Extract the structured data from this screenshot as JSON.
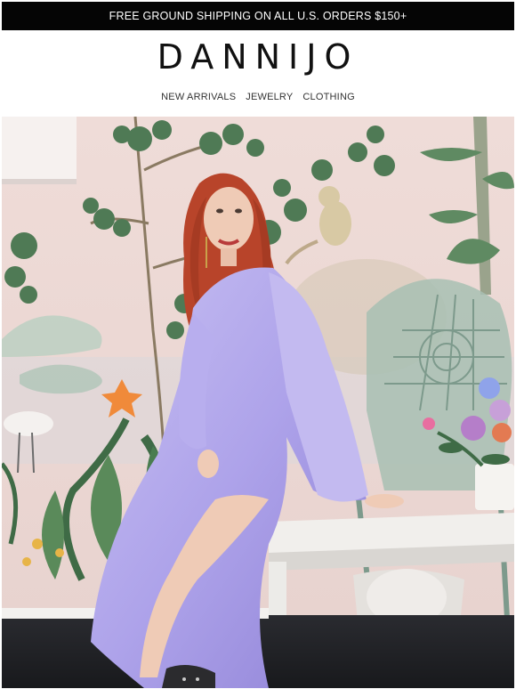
{
  "banner": {
    "text": "FREE GROUND SHIPPING ON ALL U.S. ORDERS $150+"
  },
  "brand": {
    "logo_text": "DANNIJO"
  },
  "nav": {
    "items": [
      {
        "label": "NEW ARRIVALS"
      },
      {
        "label": "JEWELRY"
      },
      {
        "label": "CLOTHING"
      }
    ]
  },
  "colors": {
    "banner_bg": "#050505",
    "wall": "#ebd8d5",
    "dress": "#b6acec",
    "hair": "#b8442a",
    "foliage": "#4f7a55",
    "chair": "#9bb4a6"
  }
}
